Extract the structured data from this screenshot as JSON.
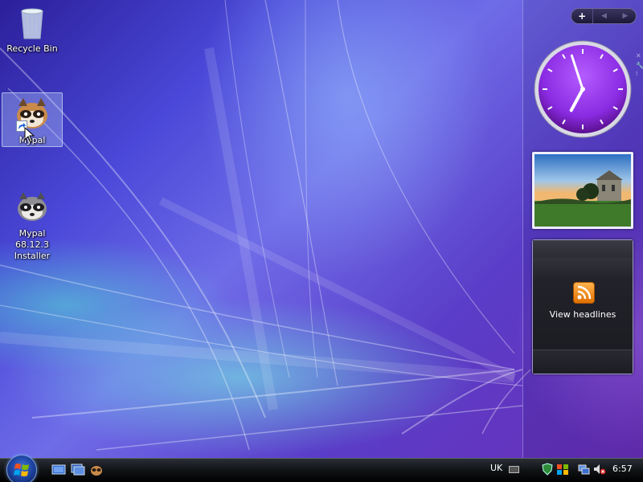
{
  "desktop": {
    "icons": [
      {
        "label": "Recycle Bin"
      },
      {
        "label": "Mypal",
        "selected": true,
        "shortcut": true
      },
      {
        "label": "Mypal 68.12.3 Installer"
      }
    ]
  },
  "sidebar": {
    "controls": {
      "add": "+",
      "prev": "◀",
      "next": "▶"
    },
    "clock": {
      "hour": 6,
      "minute": 57
    },
    "feeds": {
      "label": "View headlines"
    }
  },
  "taskbar": {
    "language": "UK",
    "time": "6:57"
  },
  "colors": {
    "clock_face": "#8a2be2",
    "taskbar": "#101316",
    "rss": "#f08a1c"
  }
}
